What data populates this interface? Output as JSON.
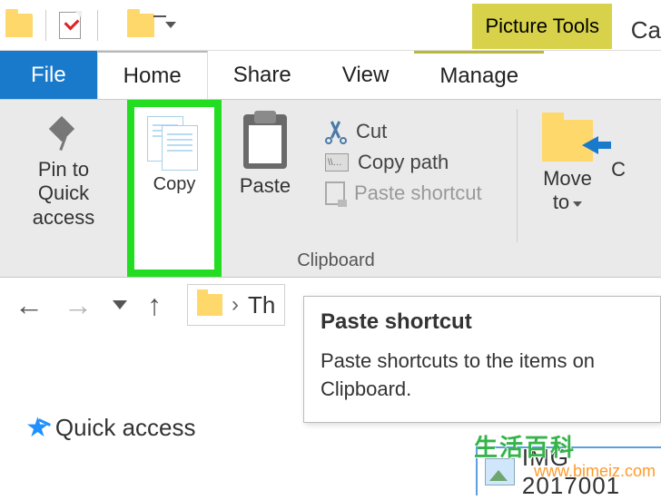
{
  "titlebar": {
    "picture_tools": "Picture Tools",
    "truncated_right": "Ca"
  },
  "tabs": {
    "file": "File",
    "home": "Home",
    "share": "Share",
    "view": "View",
    "manage": "Manage"
  },
  "ribbon": {
    "pin": "Pin to Quick access",
    "copy": "Copy",
    "paste": "Paste",
    "cut": "Cut",
    "copy_path": "Copy path",
    "paste_shortcut": "Paste shortcut",
    "group_clipboard": "Clipboard",
    "move_to": "Move to",
    "truncated_right": "C"
  },
  "address": {
    "path_fragment": "Th"
  },
  "tooltip": {
    "title": "Paste shortcut",
    "body": "Paste shortcuts to the items on Clipboard."
  },
  "sidebar": {
    "quick_access": "Quick access"
  },
  "content": {
    "filename_fragment": "IMG 2017001"
  },
  "watermark": {
    "cn": "生活百科",
    "url": "www.bimeiz.com"
  }
}
